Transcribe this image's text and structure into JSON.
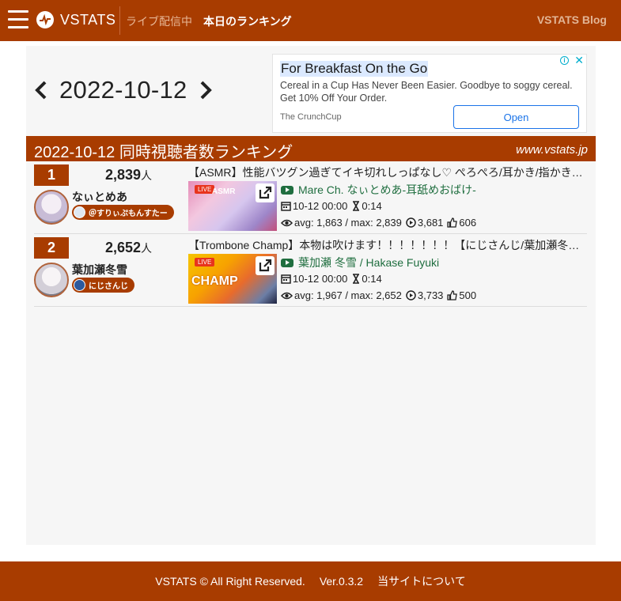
{
  "header": {
    "brand": "VSTATS",
    "nav_live": "ライブ配信中",
    "nav_ranking": "本日のランキング",
    "nav_blog": "VSTATS Blog"
  },
  "date_nav": {
    "date": "2022-10-12"
  },
  "ad": {
    "title": "For Breakfast On the Go",
    "body": "Cereal in a Cup Has Never Been Easier. Goodbye to soggy cereal. Get 10% Off Your Order.",
    "source": "The CrunchCup",
    "button": "Open",
    "info_icon": "i",
    "close_icon": "✕"
  },
  "heading": {
    "title": "2022-10-12 同時視聴者数ランキング",
    "site": "www.vstats.jp"
  },
  "rows": [
    {
      "rank": "1",
      "viewers": "2,839",
      "unit": "人",
      "channel": "なぃとめあ",
      "tag": "＠すりぃぷもんすたー",
      "title": "【ASMR】性能バツグン過ぎてイキ切れしっぱなし♡ ぺろぺろ/耳かき/指かき…",
      "live": "LIVE",
      "yt_channel": "Mare Ch. なぃとめあ-耳舐めおばけ-",
      "date": "10-12 00:00",
      "duration": "0:14",
      "stats": "avg: 1,863 / max: 2,839",
      "views": "3,681",
      "likes": "606"
    },
    {
      "rank": "2",
      "viewers": "2,652",
      "unit": "人",
      "channel": "葉加瀬冬雪",
      "tag": "にじさんじ",
      "title": "【Trombone Champ】本物は吹けます！！！！！！！【にじさんじ/葉加瀬冬…",
      "live": "LIVE",
      "yt_channel": "葉加瀬 冬雪 / Hakase Fuyuki",
      "date": "10-12 00:00",
      "duration": "0:14",
      "stats": "avg: 1,967 / max: 2,652",
      "views": "3,733",
      "likes": "500"
    }
  ],
  "footer": {
    "copyright": "VSTATS © All Right Reserved.",
    "version": "Ver.0.3.2",
    "about": "当サイトについて"
  },
  "colors": {
    "brand": "#a83c00",
    "channel_green": "#1f6e3f"
  }
}
